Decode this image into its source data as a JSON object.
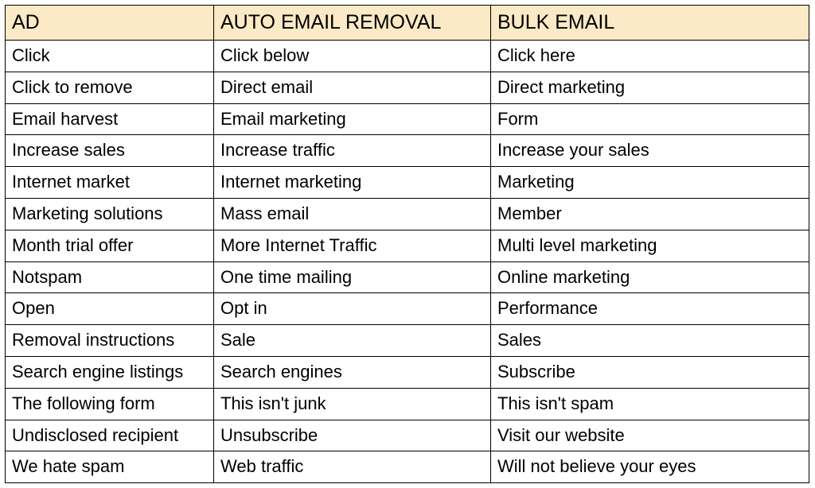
{
  "table": {
    "headers": [
      "AD",
      "AUTO EMAIL REMOVAL",
      "BULK EMAIL"
    ],
    "rows": [
      [
        "Click",
        "Click below",
        "Click here"
      ],
      [
        "Click to remove",
        "Direct email",
        "Direct marketing"
      ],
      [
        "Email harvest",
        "Email marketing",
        "Form"
      ],
      [
        "Increase sales",
        "Increase traffic",
        "Increase your sales"
      ],
      [
        "Internet market",
        "Internet marketing",
        "Marketing"
      ],
      [
        "Marketing solutions",
        "Mass email",
        "Member"
      ],
      [
        "Month trial offer",
        "More Internet Traffic",
        "Multi level marketing"
      ],
      [
        "Notspam",
        "One time mailing",
        "Online marketing"
      ],
      [
        "Open",
        "Opt in",
        "Performance"
      ],
      [
        "Removal instructions",
        "Sale",
        "Sales"
      ],
      [
        "Search engine listings",
        "Search engines",
        "Subscribe"
      ],
      [
        "The following form",
        "This isn't junk",
        "This isn't spam"
      ],
      [
        "Undisclosed recipient",
        "Unsubscribe",
        "Visit our website"
      ],
      [
        "We hate spam",
        "Web traffic",
        "Will not believe your eyes"
      ]
    ]
  }
}
